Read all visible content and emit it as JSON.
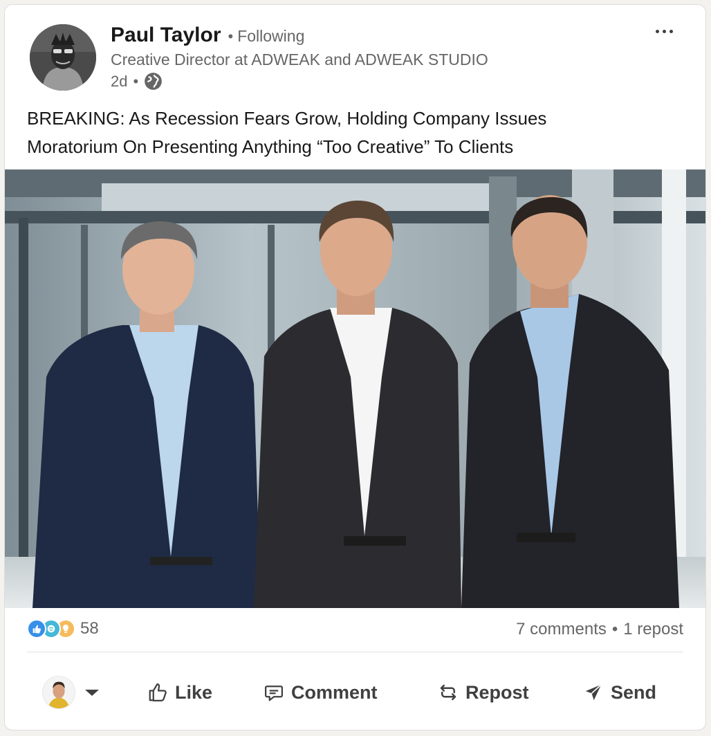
{
  "post": {
    "author": {
      "name": "Paul Taylor",
      "separator": "•",
      "follow_status": "Following",
      "headline": "Creative Director at ADWEAK and ADWEAK STUDIO",
      "time": "2d",
      "meta_separator": "•",
      "visibility_icon": "globe-icon"
    },
    "more_icon": "more-icon",
    "text_lines": [
      "BREAKING: As Recession Fears Grow, Holding Company Issues",
      "Moratorium On Presenting Anything “Too Creative” To Clients"
    ],
    "image_icon": "photo-three-men-in-suits"
  },
  "social": {
    "reaction_icons": [
      "like-reaction-icon",
      "celebrate-reaction-icon",
      "insightful-reaction-icon"
    ],
    "reaction_count": "58",
    "comments": "7 comments",
    "counts_separator": "•",
    "reposts": "1 repost"
  },
  "actions": {
    "like": "Like",
    "comment": "Comment",
    "repost": "Repost",
    "send": "Send"
  },
  "colors": {
    "like_blue": "#378fe9",
    "celebrate": "#44b8d6",
    "insightful": "#f5bb5c",
    "text_secondary": "#666666"
  }
}
